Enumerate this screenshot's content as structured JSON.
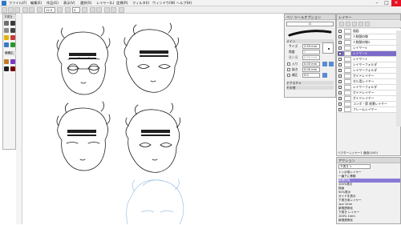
{
  "window": {
    "menus": [
      "ファイル(F)",
      "編集(E)",
      "作品(G)",
      "表示(V)",
      "選択(S)",
      "レイヤー(L)",
      "定規(R)",
      "フィルタ(I)",
      "ウィンドウ(W)",
      "ヘルプ(H)"
    ],
    "controls": {
      "minimize": "–",
      "maximize": "□",
      "close": "×"
    }
  },
  "toolbar": {
    "zoom_value": "12.5",
    "angle_value": "0"
  },
  "toolbox": {
    "header": "下書き",
    "section2": "線補正",
    "tool_colors": [
      "#6e6e6e",
      "#3a3a3a",
      "#8a8a8a",
      "#444444",
      "#e6b400",
      "#c43a3a",
      "#3a7ac4",
      "#2a9a2a",
      "#c47a2a",
      "#7a3ac4",
      "#202020",
      "#7a0000"
    ]
  },
  "brush_panel": {
    "title": "ペン ツールオプション",
    "brush_name": "G",
    "section_main": "メイン",
    "size_label": "サイズ",
    "size_value": "2.50 mm",
    "angle_label": "角度",
    "angle_value": "0",
    "min_label": "最小値",
    "min_value": "0.00 mm",
    "entry_label": "入り",
    "entry_value": "0.00 mm",
    "exit_label": "抜き",
    "exit_value": "0.00 mm",
    "smooth_label": "補正",
    "smooth_value": "5.0",
    "section_texture": "テクスチャ",
    "section_other": "その他"
  },
  "layer_panel": {
    "title": "レイヤー",
    "layers": [
      {
        "name": "描画"
      },
      {
        "name": "人物顔の線"
      },
      {
        "name": "人物顔の線2"
      },
      {
        "name": "レイヤー3"
      },
      {
        "name": "レイヤー5"
      },
      {
        "name": "レイヤー1"
      },
      {
        "name": "レイヤーフォルダ"
      },
      {
        "name": "レイヤーフォルダ"
      },
      {
        "name": "ガイドレイヤー"
      },
      {
        "name": "セル用レイヤー"
      },
      {
        "name": "レイヤーフォルダ"
      },
      {
        "name": "ガイドレイヤー"
      },
      {
        "name": "ガイドレイヤー"
      },
      {
        "name": "コンボ・第 前景レイヤー"
      },
      {
        "name": "フレームレイヤー"
      }
    ],
    "footer": "ベクターレイヤー1 通過(0/40)"
  },
  "action_panel": {
    "title": "アクション",
    "set_name": "下書き 1",
    "items": [
      "トンボ用レイヤー",
      "一番下に移動",
      "新規作成",
      "100%表示",
      "描画",
      "50%表示",
      "ガイドを表示",
      "下書き用レイヤー",
      "1px 1mm",
      "新規透明化",
      "下書き レイヤー",
      "100% 1mm",
      "新規透明化"
    ]
  },
  "colors": {
    "selected_layer": "#7c6bc8",
    "selected_action": "#8a7ad6",
    "sketch_line": "#9ec3e6",
    "ink": "#202020"
  }
}
